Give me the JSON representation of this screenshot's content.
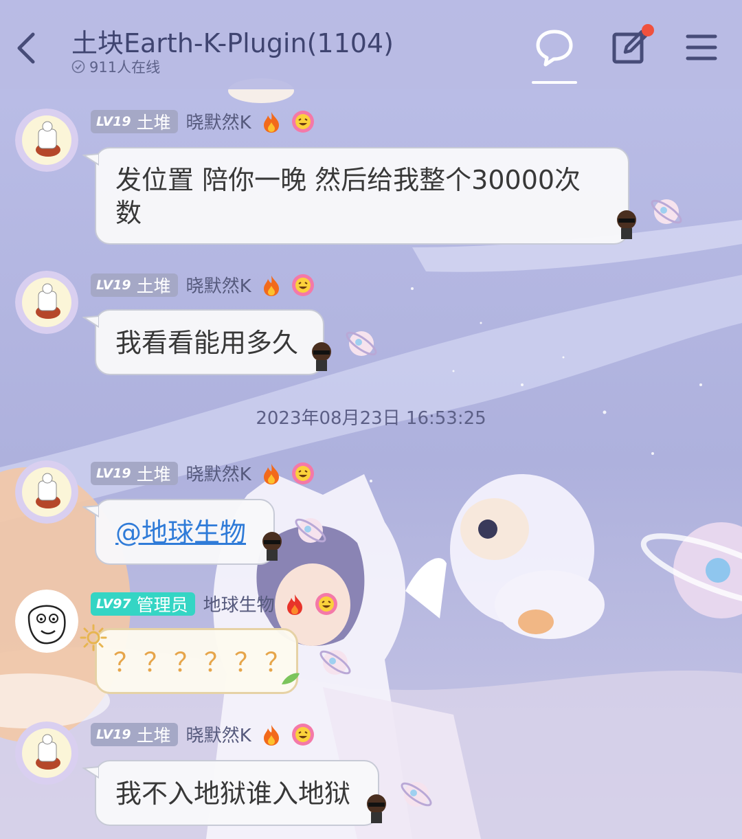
{
  "header": {
    "title": "土块Earth-K-Plugin(1104)",
    "online": "911人在线"
  },
  "timestamp": "2023年08月23日 16:53:25",
  "messages": [
    {
      "level": "LV19",
      "title": "土堆",
      "name": "晓默然K",
      "text_line1": "发位置 陪你一晚 然后给我整个30000次",
      "text_line2": "数"
    },
    {
      "level": "LV19",
      "title": "土堆",
      "name": "晓默然K",
      "text": "我看看能用多久"
    },
    {
      "level": "LV19",
      "title": "土堆",
      "name": "晓默然K",
      "text": "@地球生物"
    },
    {
      "level": "LV97",
      "title": "管理员",
      "name": "地球生物",
      "text": "？？？？？？"
    },
    {
      "level": "LV19",
      "title": "土堆",
      "name": "晓默然K",
      "text": "我不入地狱谁入地狱"
    }
  ],
  "colors": {
    "header_bg": "#b8bbe4",
    "title_text": "#3f4470",
    "badge_lv19": "#a5a8c6",
    "badge_lv97": "#34d5c4",
    "mention": "#2f7bd8",
    "notification_dot": "#f0513d"
  },
  "icons": {
    "back": "chevron-left-icon",
    "online": "check-circle-icon",
    "chat": "chat-bubble-icon",
    "edit": "edit-note-icon",
    "menu": "menu-icon",
    "fire": "fire-icon",
    "flower": "flower-emoji-icon",
    "planet": "planet-sticker-icon"
  }
}
